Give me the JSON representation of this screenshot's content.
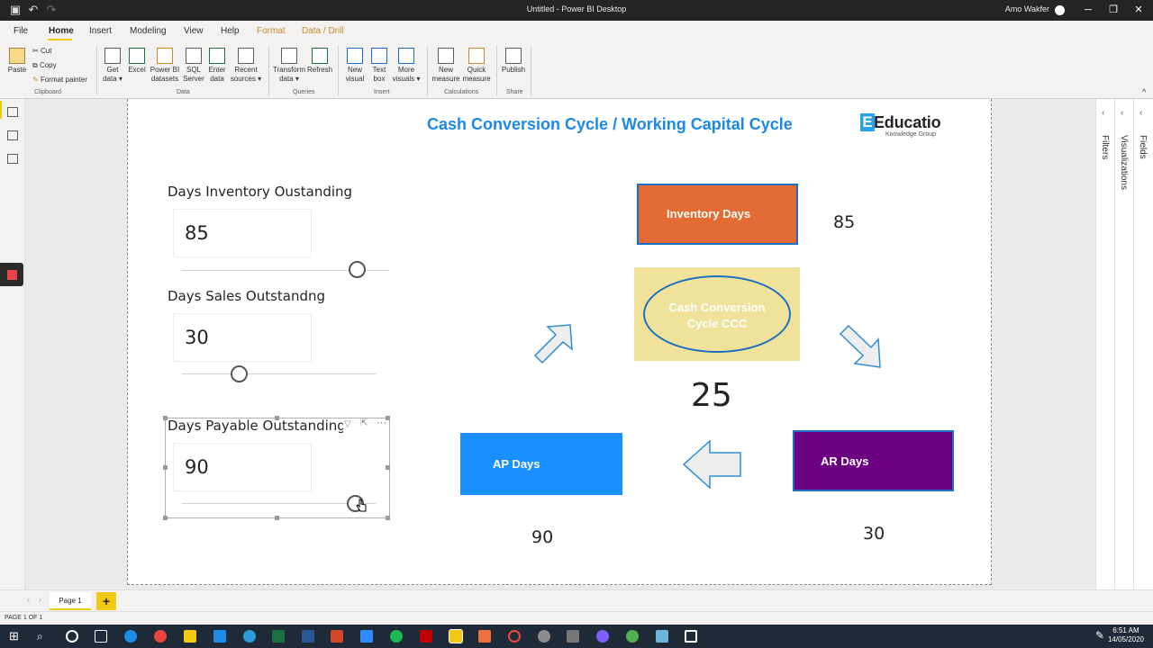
{
  "window": {
    "title": "Untitled - Power BI Desktop",
    "user": "Amo Wakfer"
  },
  "menu": [
    "File",
    "Home",
    "Insert",
    "Modeling",
    "View",
    "Help",
    "Format",
    "Data / Drill"
  ],
  "ribbon": {
    "clipboard": {
      "paste": "Paste",
      "cut": "Cut",
      "copy": "Copy",
      "format_painter": "Format painter",
      "group": "Clipboard"
    },
    "data": {
      "get_data": "Get data",
      "excel": "Excel",
      "pbi_datasets": "Power BI datasets",
      "sql": "SQL Server",
      "enter_data": "Enter data",
      "recent": "Recent sources",
      "group": "Data"
    },
    "queries": {
      "transform": "Transform data",
      "refresh": "Refresh",
      "group": "Queries"
    },
    "insert": {
      "new_visual": "New visual",
      "text_box": "Text box",
      "more_visuals": "More visuals",
      "group": "Insert"
    },
    "calculations": {
      "new_measure": "New measure",
      "quick_measure": "Quick measure",
      "group": "Calculations"
    },
    "share": {
      "publish": "Publish",
      "group": "Share"
    }
  },
  "panes": {
    "filters": "Filters",
    "visualizations": "Visualizations",
    "fields": "Fields"
  },
  "report": {
    "title": "Cash Conversion Cycle / Working Capital Cycle",
    "logo": {
      "main": "Educatio",
      "sub": "Knowledge Group"
    },
    "sliders": [
      {
        "label": "Days Inventory Oustanding",
        "value": "85",
        "fraction": 0.84
      },
      {
        "label": "Days Sales Outstandng",
        "value": "30",
        "fraction": 0.3
      },
      {
        "label": "Days Payable Outstanding",
        "value": "90",
        "fraction": 0.9
      }
    ],
    "shapes": {
      "inventory": "Inventory Days",
      "ccc": "Cash Conversion Cycle CCC",
      "ar": "AR Days",
      "ap": "AP Days"
    },
    "values": {
      "inventory": "85",
      "ccc": "25",
      "ar": "30",
      "ap": "90"
    }
  },
  "pages": {
    "tab": "Page 1",
    "add": "+"
  },
  "status": "PAGE 1 OF 1",
  "clock": {
    "time": "6:51 AM",
    "date": "14/05/2020"
  },
  "colors": {
    "title_blue": "#1e88e5",
    "inventory": "#e46c34",
    "ccc_fill": "#f0e19b",
    "ar": "#6b0080",
    "ap": "#1a8fff",
    "accent": "#f2c811"
  }
}
